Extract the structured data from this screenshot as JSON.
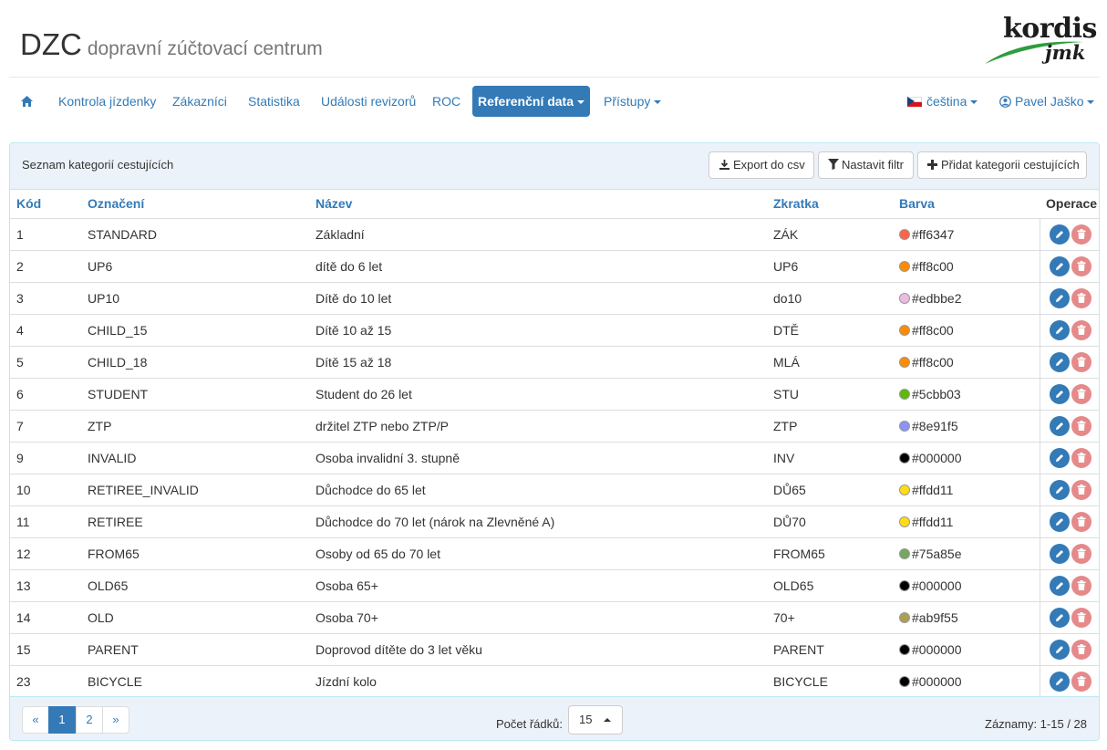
{
  "brand": {
    "title": "DZC",
    "subtitle": "dopravní zúčtovací centrum"
  },
  "logo": {
    "top": "kordis",
    "bottom": "jmk"
  },
  "nav": {
    "home_icon": "home-icon",
    "items": [
      "Kontrola jízdenky",
      "Zákazníci",
      "Statistika",
      "Události revizorů",
      "ROC"
    ],
    "active": "Referenční data",
    "access": "Přístupy",
    "language": "čeština",
    "user": "Pavel Jaško"
  },
  "panel": {
    "title": "Seznam kategorií cestujících",
    "export_label": "Export do csv",
    "filter_label": "Nastavit filtr",
    "add_label": "Přidat kategorii cestujících"
  },
  "table": {
    "columns": [
      "Kód",
      "Označení",
      "Název",
      "Zkratka",
      "Barva",
      "Operace"
    ],
    "rows": [
      {
        "code": "1",
        "name": "STANDARD",
        "title": "Základní",
        "abbr": "ZÁK",
        "color": "#ff6347"
      },
      {
        "code": "2",
        "name": "UP6",
        "title": "dítě do 6 let",
        "abbr": "UP6",
        "color": "#ff8c00"
      },
      {
        "code": "3",
        "name": "UP10",
        "title": "Dítě do 10 let",
        "abbr": "do10",
        "color": "#edbbe2"
      },
      {
        "code": "4",
        "name": "CHILD_15",
        "title": "Dítě 10 až 15",
        "abbr": "DTĚ",
        "color": "#ff8c00"
      },
      {
        "code": "5",
        "name": "CHILD_18",
        "title": "Dítě 15 až 18",
        "abbr": "MLÁ",
        "color": "#ff8c00"
      },
      {
        "code": "6",
        "name": "STUDENT",
        "title": "Student do 26 let",
        "abbr": "STU",
        "color": "#5cbb03"
      },
      {
        "code": "7",
        "name": "ZTP",
        "title": "držitel ZTP nebo ZTP/P",
        "abbr": "ZTP",
        "color": "#8e91f5"
      },
      {
        "code": "9",
        "name": "INVALID",
        "title": "Osoba invalidní 3. stupně",
        "abbr": "INV",
        "color": "#000000"
      },
      {
        "code": "10",
        "name": "RETIREE_INVALID",
        "title": "Důchodce do 65 let",
        "abbr": "DŮ65",
        "color": "#ffdd11"
      },
      {
        "code": "11",
        "name": "RETIREE",
        "title": "Důchodce do 70 let (nárok na Zlevněné A)",
        "abbr": "DŮ70",
        "color": "#ffdd11"
      },
      {
        "code": "12",
        "name": "FROM65",
        "title": "Osoby od 65 do 70 let",
        "abbr": "FROM65",
        "color": "#75a85e"
      },
      {
        "code": "13",
        "name": "OLD65",
        "title": "Osoba 65+",
        "abbr": "OLD65",
        "color": "#000000"
      },
      {
        "code": "14",
        "name": "OLD",
        "title": "Osoba 70+",
        "abbr": "70+",
        "color": "#ab9f55"
      },
      {
        "code": "15",
        "name": "PARENT",
        "title": "Doprovod dítěte do 3 let věku",
        "abbr": "PARENT",
        "color": "#000000"
      },
      {
        "code": "23",
        "name": "BICYCLE",
        "title": "Jízdní kolo",
        "abbr": "BICYCLE",
        "color": "#000000"
      }
    ]
  },
  "footer": {
    "pages": [
      "«",
      "1",
      "2",
      "»"
    ],
    "current_page": "1",
    "rows_label": "Počet řádků:",
    "rows_value": "15",
    "records": "Záznamy: 1-15 / 28"
  },
  "colors": {
    "accent": "#337ab7",
    "panel_bg": "#ecf2f9",
    "delete": "#e6898a"
  }
}
